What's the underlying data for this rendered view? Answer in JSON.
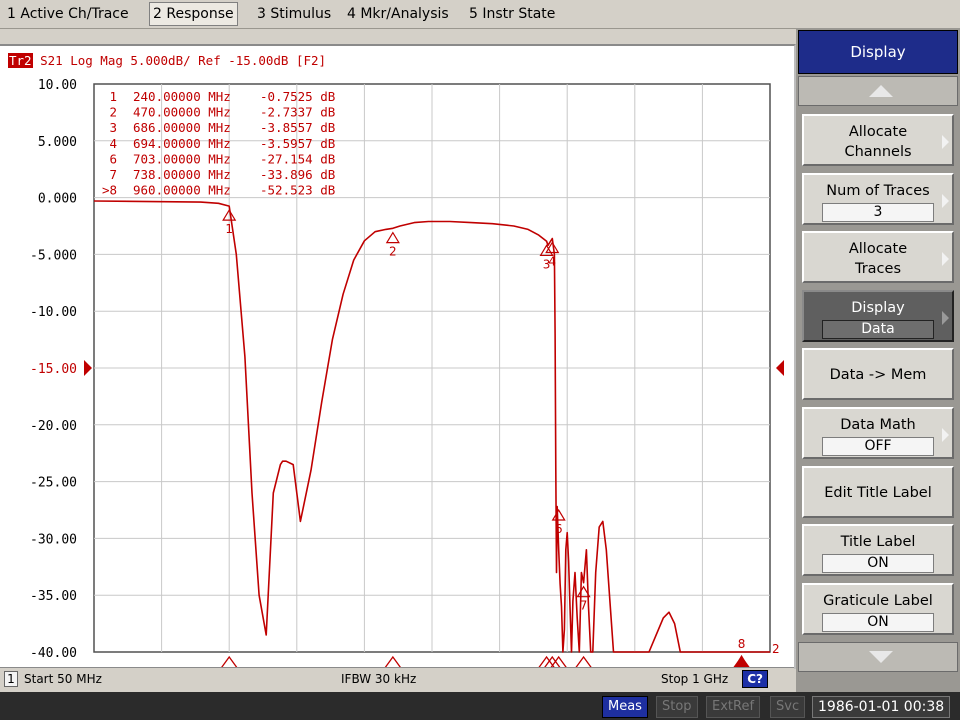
{
  "menu": {
    "items": [
      {
        "label": "1 Active Ch/Trace"
      },
      {
        "label": "2 Response"
      },
      {
        "label": "3 Stimulus"
      },
      {
        "label": "4 Mkr/Analysis"
      },
      {
        "label": "5 Instr State"
      }
    ]
  },
  "trace_header": {
    "tag": "Tr2",
    "text": " S21 Log Mag 5.000dB/ Ref -15.00dB [F2]"
  },
  "markers_table": [
    {
      "id": "1",
      "freq": "240.00000 MHz",
      "value": "-0.7525 dB"
    },
    {
      "id": "2",
      "freq": "470.00000 MHz",
      "value": "-2.7337 dB"
    },
    {
      "id": "3",
      "freq": "686.00000 MHz",
      "value": "-3.8557 dB"
    },
    {
      "id": "4",
      "freq": "694.00000 MHz",
      "value": "-3.5957 dB"
    },
    {
      "id": "6",
      "freq": "703.00000 MHz",
      "value": "-27.154 dB"
    },
    {
      "id": "7",
      "freq": "738.00000 MHz",
      "value": "-33.896 dB"
    },
    {
      "id": ">8",
      "freq": "960.00000 MHz",
      "value": "-52.523 dB"
    }
  ],
  "chart_data": {
    "type": "line",
    "x_start_mhz": 50,
    "x_stop_mhz": 1000,
    "ylim": [
      -40,
      10
    ],
    "y_ticks": [
      "10.00",
      "5.000",
      "0.000",
      "-5.000",
      "-10.00",
      "-15.00",
      "-20.00",
      "-25.00",
      "-30.00",
      "-35.00",
      "-40.00"
    ],
    "ref_level": "-15.00",
    "ref_channel_label": "2",
    "grid": true,
    "color": "#c00000",
    "series": [
      {
        "x": [
          50,
          200,
          225,
          240,
          250,
          262,
          272,
          282,
          292,
          302,
          312,
          315,
          320,
          330,
          340,
          355,
          370,
          385,
          400,
          415,
          430,
          445,
          460,
          470,
          480,
          500,
          520,
          550,
          580,
          610,
          640,
          660,
          675,
          686,
          688,
          690,
          694,
          697,
          698,
          699,
          700,
          701,
          702,
          703,
          705,
          707,
          709,
          711,
          713,
          715,
          717,
          719,
          721,
          723,
          726,
          729,
          732,
          735,
          738,
          742,
          745,
          748,
          751,
          755,
          760,
          765,
          770,
          780,
          830,
          850,
          858,
          866,
          874,
          900,
          950,
          960,
          1000
        ],
        "y": [
          -0.3,
          -0.4,
          -0.5,
          -0.75,
          -5,
          -14,
          -26,
          -35,
          -38.5,
          -26,
          -23.5,
          -23.2,
          -23.2,
          -23.5,
          -28.5,
          -24,
          -18,
          -12.5,
          -8.5,
          -5.5,
          -3.8,
          -3.0,
          -2.8,
          -2.7,
          -2.5,
          -2.2,
          -2.1,
          -2.1,
          -2.2,
          -2.3,
          -2.5,
          -2.8,
          -3.3,
          -3.85,
          -4.2,
          -4.0,
          -3.6,
          -5,
          -12,
          -24,
          -33,
          -27.2,
          -29,
          -31,
          -34,
          -36,
          -40,
          -38,
          -31,
          -29.5,
          -32,
          -36,
          -40,
          -35.5,
          -33,
          -37,
          -40,
          -33,
          -33.9,
          -31,
          -36,
          -40,
          -40,
          -33,
          -29,
          -28.5,
          -31,
          -40,
          -40,
          -37,
          -36.5,
          -37.5,
          -40,
          -40,
          -40,
          -40,
          -40
        ]
      }
    ],
    "markers": [
      {
        "label": "1",
        "x": 240,
        "y": -0.75
      },
      {
        "label": "2",
        "x": 470,
        "y": -2.73
      },
      {
        "label": "3",
        "x": 686,
        "y": -3.86
      },
      {
        "label": "4",
        "x": 694,
        "y": -3.6
      },
      {
        "label": "6",
        "x": 703,
        "y": -27.15
      },
      {
        "label": "7",
        "x": 738,
        "y": -33.9
      },
      {
        "label": "8",
        "x": 960,
        "y": -40,
        "active": true
      }
    ]
  },
  "status": {
    "channel": "1",
    "start": "Start 50 MHz",
    "ifbw": "IFBW 30 kHz",
    "stop": "Stop 1 GHz",
    "badge": "C?"
  },
  "bottom_bar": {
    "meas": "Meas",
    "stop": "Stop",
    "extref": "ExtRef",
    "svc": "Svc",
    "datetime": "1986-01-01 00:38"
  },
  "softkeys": {
    "title": "Display",
    "keys": [
      {
        "line1": "Allocate",
        "line2": "Channels"
      },
      {
        "line1": "Num of Traces",
        "value": "3"
      },
      {
        "line1": "Allocate",
        "line2": "Traces"
      },
      {
        "line1": "Display",
        "value": "Data"
      },
      {
        "line1": "Data -> Mem"
      },
      {
        "line1": "Data Math",
        "value": "OFF"
      },
      {
        "line1": "Edit Title Label"
      },
      {
        "line1": "Title Label",
        "value": "ON"
      },
      {
        "line1": "Graticule Label",
        "value": "ON"
      }
    ]
  }
}
